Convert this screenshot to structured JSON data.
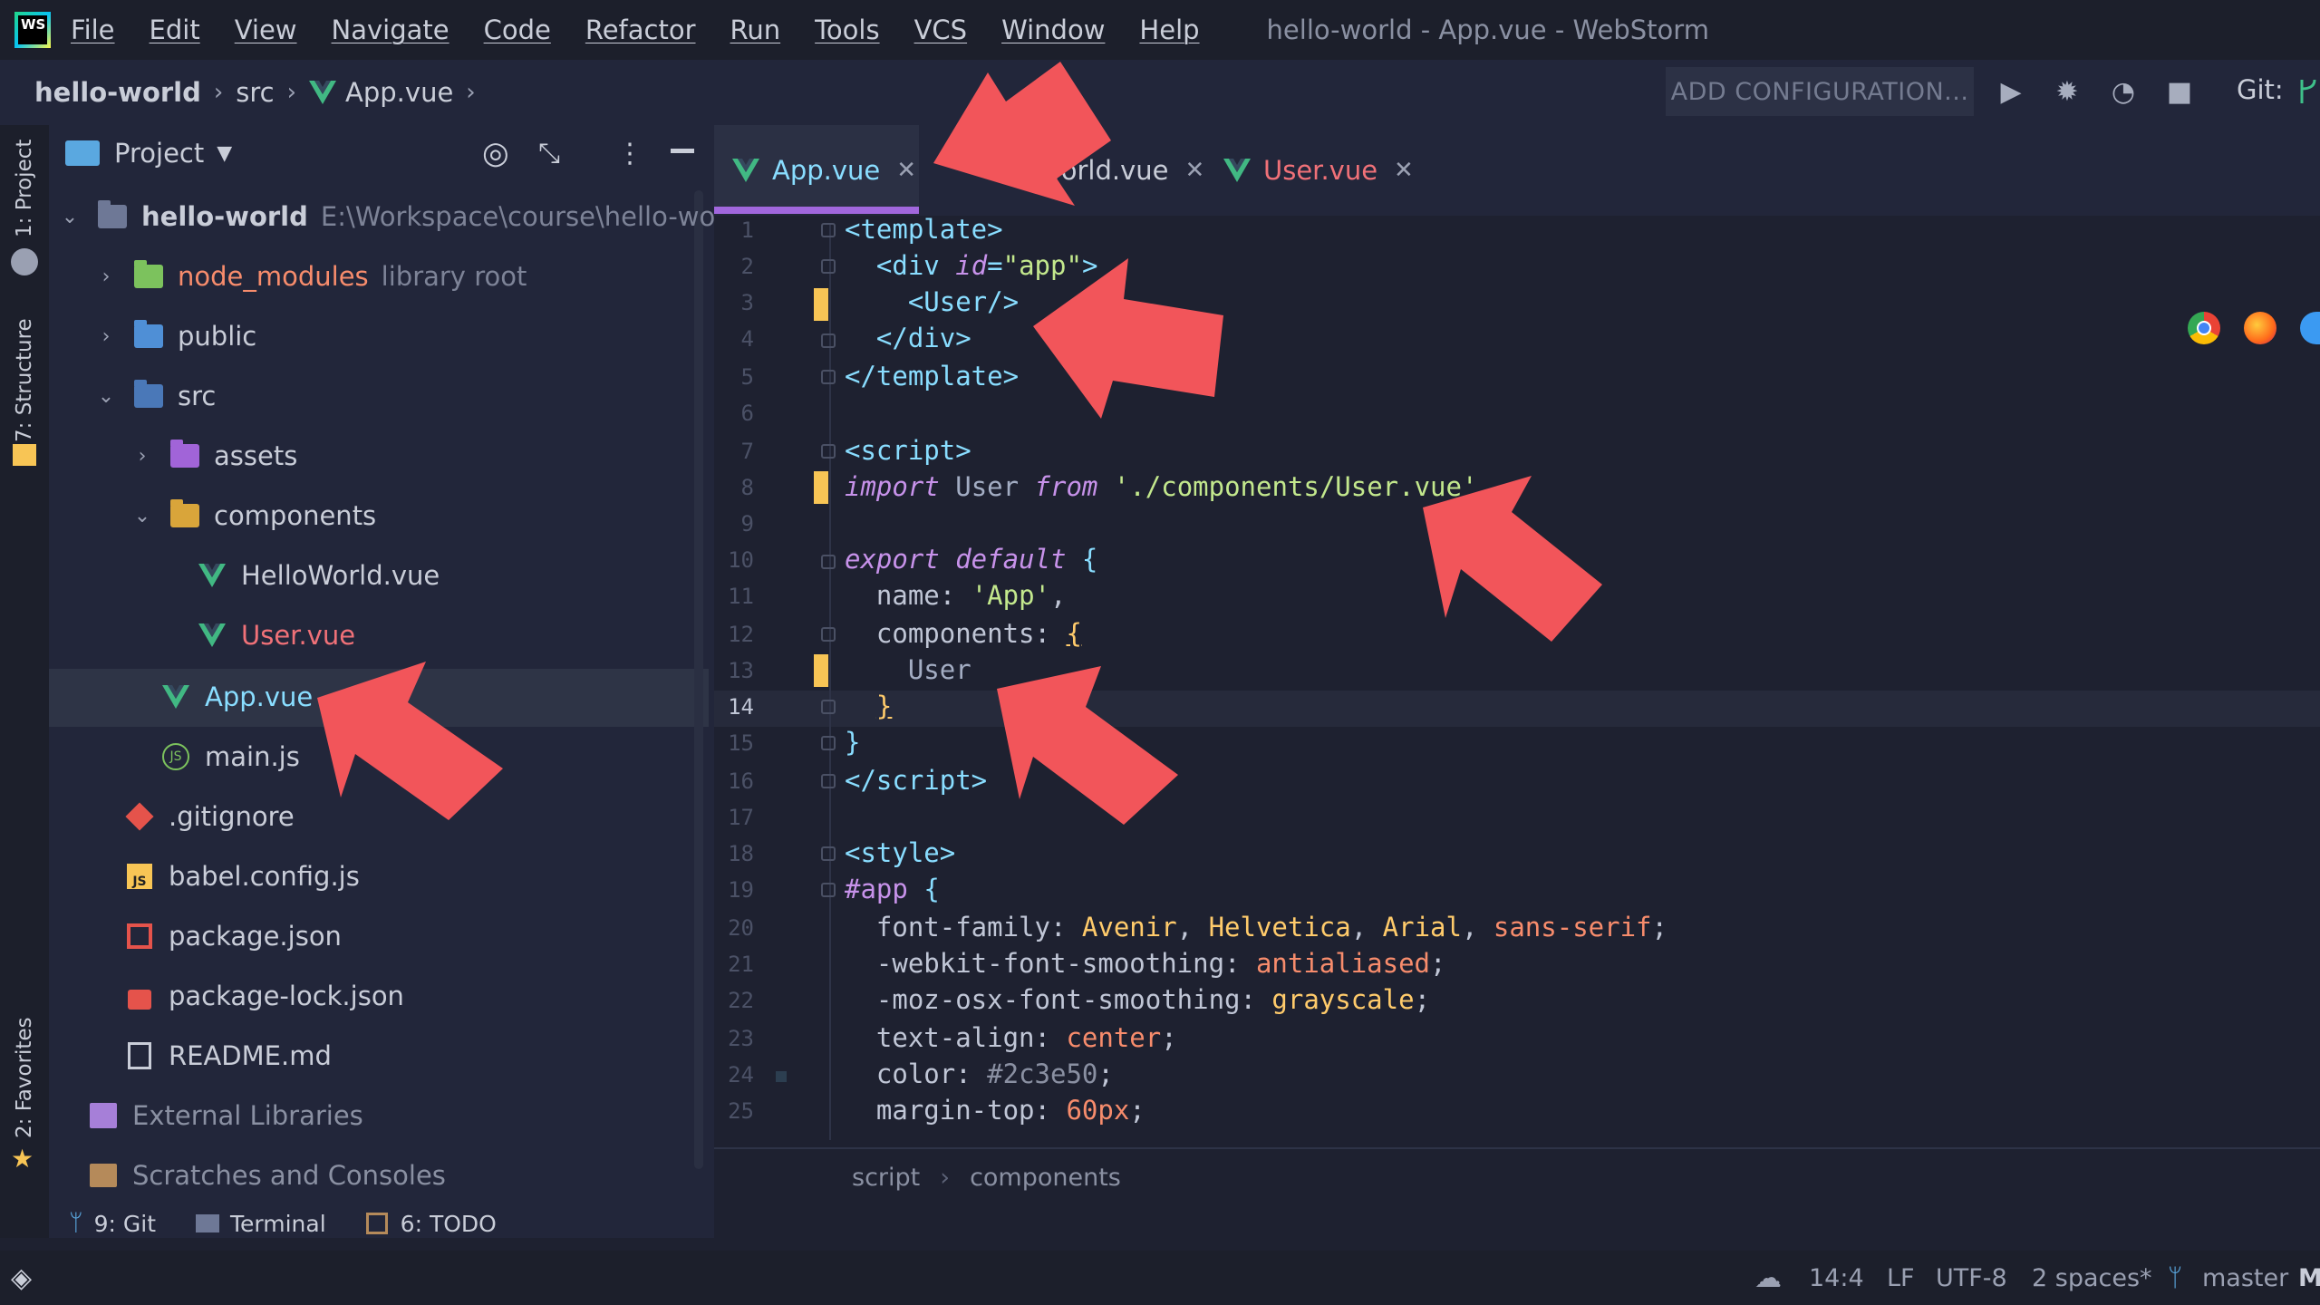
{
  "menubar": {
    "logo_text": "WS",
    "items": [
      "File",
      "Edit",
      "View",
      "Navigate",
      "Code",
      "Refactor",
      "Run",
      "Tools",
      "VCS",
      "Window",
      "Help"
    ],
    "window_title": "hello-world - App.vue - WebStorm"
  },
  "navbar": {
    "crumbs": [
      "hello-world",
      "src",
      "App.vue"
    ],
    "add_configuration": "ADD CONFIGURATION...",
    "git_label": "Git:"
  },
  "left_strip": {
    "project": "1: Project",
    "structure": "7: Structure",
    "favorites": "2: Favorites"
  },
  "project_panel": {
    "title": "Project",
    "tree": [
      {
        "label": "hello-world",
        "extra": "E:\\Workspace\\course\\hello-world"
      },
      {
        "label": "node_modules",
        "extra": "library root"
      },
      {
        "label": "public"
      },
      {
        "label": "src"
      },
      {
        "label": "assets"
      },
      {
        "label": "components"
      },
      {
        "label": "HelloWorld.vue"
      },
      {
        "label": "User.vue"
      },
      {
        "label": "App.vue"
      },
      {
        "label": "main.js"
      },
      {
        "label": ".gitignore"
      },
      {
        "label": "babel.config.js"
      },
      {
        "label": "package.json"
      },
      {
        "label": "package-lock.json"
      },
      {
        "label": "README.md"
      },
      {
        "label": "External Libraries"
      },
      {
        "label": "Scratches and Consoles"
      }
    ]
  },
  "tabs": [
    {
      "label": "App.vue"
    },
    {
      "label": "oWorld.vue"
    },
    {
      "label": "User.vue"
    }
  ],
  "editor": {
    "line_numbers": [
      "1",
      "2",
      "3",
      "4",
      "5",
      "6",
      "7",
      "8",
      "9",
      "10",
      "11",
      "12",
      "13",
      "14",
      "15",
      "16",
      "17",
      "18",
      "19",
      "20",
      "21",
      "22",
      "23",
      "24",
      "25"
    ],
    "breadcrumb": [
      "script",
      "components"
    ]
  },
  "bottom_tools": {
    "git": "9: Git",
    "terminal": "Terminal",
    "todo": "6: TODO"
  },
  "status": {
    "position": "14:4",
    "line_sep": "LF",
    "encoding": "UTF-8",
    "indent": "2 spaces*",
    "branch": "master"
  },
  "colors": {
    "accent": "#a167dd",
    "arrow": "#f2555a",
    "change_marker": "#f8c555"
  }
}
